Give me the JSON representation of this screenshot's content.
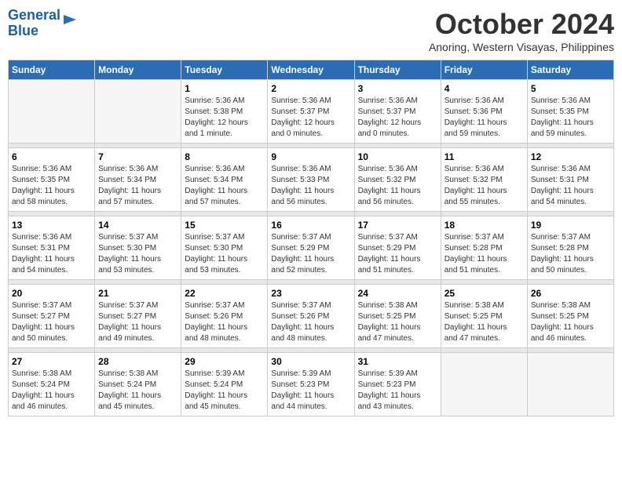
{
  "header": {
    "logo_line1": "General",
    "logo_line2": "Blue",
    "month": "October 2024",
    "location": "Anoring, Western Visayas, Philippines"
  },
  "weekdays": [
    "Sunday",
    "Monday",
    "Tuesday",
    "Wednesday",
    "Thursday",
    "Friday",
    "Saturday"
  ],
  "weeks": [
    [
      {
        "day": "",
        "info": ""
      },
      {
        "day": "",
        "info": ""
      },
      {
        "day": "1",
        "info": "Sunrise: 5:36 AM\nSunset: 5:38 PM\nDaylight: 12 hours\nand 1 minute."
      },
      {
        "day": "2",
        "info": "Sunrise: 5:36 AM\nSunset: 5:37 PM\nDaylight: 12 hours\nand 0 minutes."
      },
      {
        "day": "3",
        "info": "Sunrise: 5:36 AM\nSunset: 5:37 PM\nDaylight: 12 hours\nand 0 minutes."
      },
      {
        "day": "4",
        "info": "Sunrise: 5:36 AM\nSunset: 5:36 PM\nDaylight: 11 hours\nand 59 minutes."
      },
      {
        "day": "5",
        "info": "Sunrise: 5:36 AM\nSunset: 5:35 PM\nDaylight: 11 hours\nand 59 minutes."
      }
    ],
    [
      {
        "day": "6",
        "info": "Sunrise: 5:36 AM\nSunset: 5:35 PM\nDaylight: 11 hours\nand 58 minutes."
      },
      {
        "day": "7",
        "info": "Sunrise: 5:36 AM\nSunset: 5:34 PM\nDaylight: 11 hours\nand 57 minutes."
      },
      {
        "day": "8",
        "info": "Sunrise: 5:36 AM\nSunset: 5:34 PM\nDaylight: 11 hours\nand 57 minutes."
      },
      {
        "day": "9",
        "info": "Sunrise: 5:36 AM\nSunset: 5:33 PM\nDaylight: 11 hours\nand 56 minutes."
      },
      {
        "day": "10",
        "info": "Sunrise: 5:36 AM\nSunset: 5:32 PM\nDaylight: 11 hours\nand 56 minutes."
      },
      {
        "day": "11",
        "info": "Sunrise: 5:36 AM\nSunset: 5:32 PM\nDaylight: 11 hours\nand 55 minutes."
      },
      {
        "day": "12",
        "info": "Sunrise: 5:36 AM\nSunset: 5:31 PM\nDaylight: 11 hours\nand 54 minutes."
      }
    ],
    [
      {
        "day": "13",
        "info": "Sunrise: 5:36 AM\nSunset: 5:31 PM\nDaylight: 11 hours\nand 54 minutes."
      },
      {
        "day": "14",
        "info": "Sunrise: 5:37 AM\nSunset: 5:30 PM\nDaylight: 11 hours\nand 53 minutes."
      },
      {
        "day": "15",
        "info": "Sunrise: 5:37 AM\nSunset: 5:30 PM\nDaylight: 11 hours\nand 53 minutes."
      },
      {
        "day": "16",
        "info": "Sunrise: 5:37 AM\nSunset: 5:29 PM\nDaylight: 11 hours\nand 52 minutes."
      },
      {
        "day": "17",
        "info": "Sunrise: 5:37 AM\nSunset: 5:29 PM\nDaylight: 11 hours\nand 51 minutes."
      },
      {
        "day": "18",
        "info": "Sunrise: 5:37 AM\nSunset: 5:28 PM\nDaylight: 11 hours\nand 51 minutes."
      },
      {
        "day": "19",
        "info": "Sunrise: 5:37 AM\nSunset: 5:28 PM\nDaylight: 11 hours\nand 50 minutes."
      }
    ],
    [
      {
        "day": "20",
        "info": "Sunrise: 5:37 AM\nSunset: 5:27 PM\nDaylight: 11 hours\nand 50 minutes."
      },
      {
        "day": "21",
        "info": "Sunrise: 5:37 AM\nSunset: 5:27 PM\nDaylight: 11 hours\nand 49 minutes."
      },
      {
        "day": "22",
        "info": "Sunrise: 5:37 AM\nSunset: 5:26 PM\nDaylight: 11 hours\nand 48 minutes."
      },
      {
        "day": "23",
        "info": "Sunrise: 5:37 AM\nSunset: 5:26 PM\nDaylight: 11 hours\nand 48 minutes."
      },
      {
        "day": "24",
        "info": "Sunrise: 5:38 AM\nSunset: 5:25 PM\nDaylight: 11 hours\nand 47 minutes."
      },
      {
        "day": "25",
        "info": "Sunrise: 5:38 AM\nSunset: 5:25 PM\nDaylight: 11 hours\nand 47 minutes."
      },
      {
        "day": "26",
        "info": "Sunrise: 5:38 AM\nSunset: 5:25 PM\nDaylight: 11 hours\nand 46 minutes."
      }
    ],
    [
      {
        "day": "27",
        "info": "Sunrise: 5:38 AM\nSunset: 5:24 PM\nDaylight: 11 hours\nand 46 minutes."
      },
      {
        "day": "28",
        "info": "Sunrise: 5:38 AM\nSunset: 5:24 PM\nDaylight: 11 hours\nand 45 minutes."
      },
      {
        "day": "29",
        "info": "Sunrise: 5:39 AM\nSunset: 5:24 PM\nDaylight: 11 hours\nand 45 minutes."
      },
      {
        "day": "30",
        "info": "Sunrise: 5:39 AM\nSunset: 5:23 PM\nDaylight: 11 hours\nand 44 minutes."
      },
      {
        "day": "31",
        "info": "Sunrise: 5:39 AM\nSunset: 5:23 PM\nDaylight: 11 hours\nand 43 minutes."
      },
      {
        "day": "",
        "info": ""
      },
      {
        "day": "",
        "info": ""
      }
    ]
  ]
}
